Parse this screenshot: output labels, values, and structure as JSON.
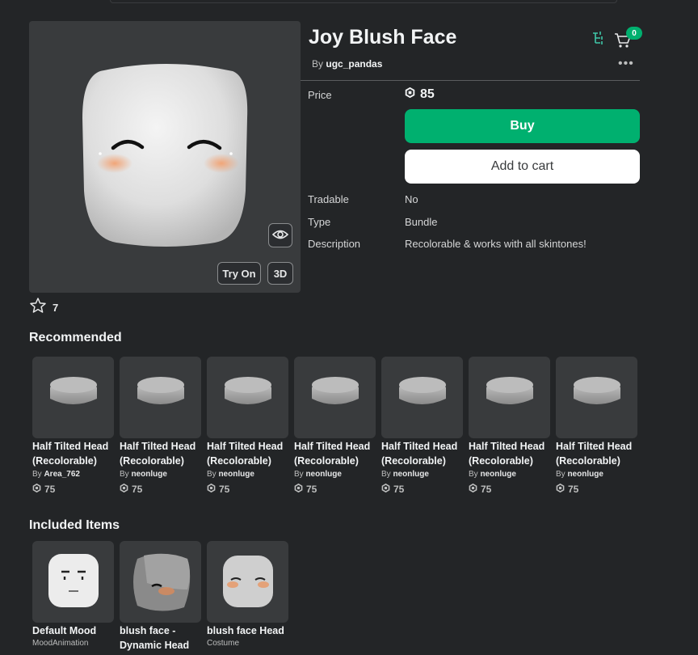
{
  "item": {
    "title": "Joy Blush Face",
    "creator_prefix": "By",
    "creator_name": "ugc_pandas",
    "favorites": "7"
  },
  "preview": {
    "try_on_label": "Try On",
    "three_d_label": "3D"
  },
  "header": {
    "cart_count": "0",
    "more_label": "•••"
  },
  "details": {
    "price_label": "Price",
    "price_value": "85",
    "buy_label": "Buy",
    "add_to_cart_label": "Add to cart",
    "tradable_label": "Tradable",
    "tradable_value": "No",
    "type_label": "Type",
    "type_value": "Bundle",
    "description_label": "Description",
    "description_value": "Recolorable & works with all skintones!"
  },
  "recommended": {
    "title": "Recommended",
    "by_prefix": "By",
    "items": [
      {
        "name1": "Half Tilted Head",
        "name2": "(Recolorable)",
        "creator": "Area_762",
        "price": "75"
      },
      {
        "name1": "Half Tilted Head",
        "name2": "(Recolorable)",
        "creator": "neonluge",
        "price": "75"
      },
      {
        "name1": "Half Tilted Head",
        "name2": "(Recolorable)",
        "creator": "neonluge",
        "price": "75"
      },
      {
        "name1": "Half Tilted Head",
        "name2": "(Recolorable)",
        "creator": "neonluge",
        "price": "75"
      },
      {
        "name1": "Half Tilted Head",
        "name2": "(Recolorable)",
        "creator": "neonluge",
        "price": "75"
      },
      {
        "name1": "Half Tilted Head",
        "name2": "(Recolorable)",
        "creator": "neonluge",
        "price": "75"
      },
      {
        "name1": "Half Tilted Head",
        "name2": "(Recolorable)",
        "creator": "neonluge",
        "price": "75"
      }
    ]
  },
  "included": {
    "title": "Included Items",
    "items": [
      {
        "name1": "Default Mood",
        "name2": "",
        "sub": "MoodAnimation"
      },
      {
        "name1": "blush face -",
        "name2": "Dynamic Head",
        "sub": ""
      },
      {
        "name1": "blush face Head",
        "name2": "",
        "sub": "Costume"
      }
    ]
  },
  "colors": {
    "background": "#232527",
    "panel": "#393b3d",
    "buy_green": "#00b06f",
    "blush": "#f0a070"
  },
  "icons": [
    "star-icon",
    "eye-icon",
    "robux-icon",
    "cart-icon",
    "outfit-tree-icon",
    "more-icon"
  ]
}
